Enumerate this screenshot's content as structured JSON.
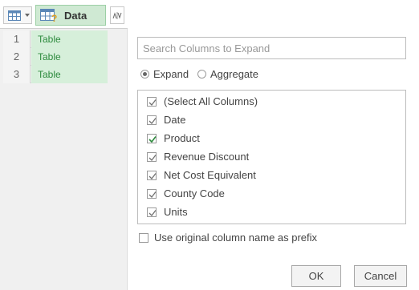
{
  "grid": {
    "header": {
      "column_name": "Data"
    },
    "rows": [
      {
        "num": "1",
        "value": "Table"
      },
      {
        "num": "2",
        "value": "Table"
      },
      {
        "num": "3",
        "value": "Table"
      }
    ]
  },
  "search": {
    "placeholder": "Search Columns to Expand",
    "value": ""
  },
  "mode": {
    "expand_label": "Expand",
    "aggregate_label": "Aggregate",
    "selected": "Expand"
  },
  "columns": {
    "items": [
      {
        "label": "(Select All Columns)",
        "checked": true
      },
      {
        "label": "Date",
        "checked": true
      },
      {
        "label": "Product",
        "checked": true
      },
      {
        "label": "Revenue Discount",
        "checked": true
      },
      {
        "label": "Net Cost Equivalent",
        "checked": true
      },
      {
        "label": "County Code",
        "checked": true
      },
      {
        "label": "Units",
        "checked": true
      }
    ]
  },
  "prefix": {
    "label": "Use original column name as prefix",
    "checked": false
  },
  "buttons": {
    "ok": "OK",
    "cancel": "Cancel"
  },
  "colors": {
    "accent_green": "#2e8b3e",
    "cell_fill": "#d6efda"
  },
  "icons": {
    "table_menu": "table-icon",
    "column_type": "table-column-type-icon",
    "expand": "expand-arrows-icon",
    "check": "checkmark-icon"
  }
}
